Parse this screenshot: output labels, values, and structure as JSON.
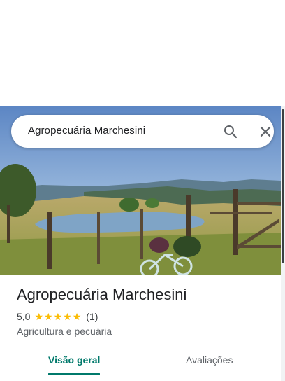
{
  "search": {
    "query": "Agropecuária Marchesini"
  },
  "photo": {
    "description_icon": "landscape-photo"
  },
  "place": {
    "name": "Agropecuária Marchesini",
    "rating": "5,0",
    "stars": 5,
    "review_count": "(1)",
    "category": "Agricultura e pecuária"
  },
  "tabs": [
    {
      "label": "Visão geral",
      "selected": true
    },
    {
      "label": "Avaliações",
      "selected": false
    }
  ],
  "colors": {
    "accent": "#00796b",
    "star": "#fbbc04",
    "title": "#202124",
    "secondary": "#5f6368"
  },
  "icons": {
    "search": "search-icon",
    "close": "close-icon",
    "star": "star-icon"
  }
}
